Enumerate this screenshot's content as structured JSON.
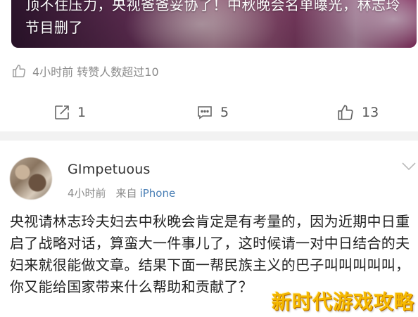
{
  "media_card": {
    "headline": "顶不住压力，央视爸爸妥协了！中秋晚会名单曝光，林志玲节目删了"
  },
  "article_meta": {
    "time_text": "4小时前 转赞人数超过10"
  },
  "action_bar": {
    "repost_count": "1",
    "comment_count": "5",
    "like_count": "13"
  },
  "post": {
    "username": "GImpetuous",
    "time": "4小时前",
    "source_prefix": "来自",
    "source": "iPhone",
    "body": "央视请林志玲夫妇去中秋晚会肯定是有考量的，因为近期中日重启了战略对话，算蛮大一件事儿了，这时候请一对中日结合的夫妇来就很能做文章。结果下面一帮民族主义的巴子叫叫叫叫叫，你又能给国家带来什么帮助和贡献了？"
  },
  "watermark": {
    "text": "新时代游戏攻略"
  },
  "colors": {
    "link_blue": "#4a7fb5",
    "meta_gray": "#8a8a8a",
    "separator": "#f2f2f2",
    "watermark_gold": "#f5b800"
  },
  "icons": {
    "meta": "thumbs-up-icon",
    "repost": "repost-icon",
    "comment": "comment-icon",
    "like": "thumbs-up-icon",
    "expand": "chevron-down-icon"
  }
}
